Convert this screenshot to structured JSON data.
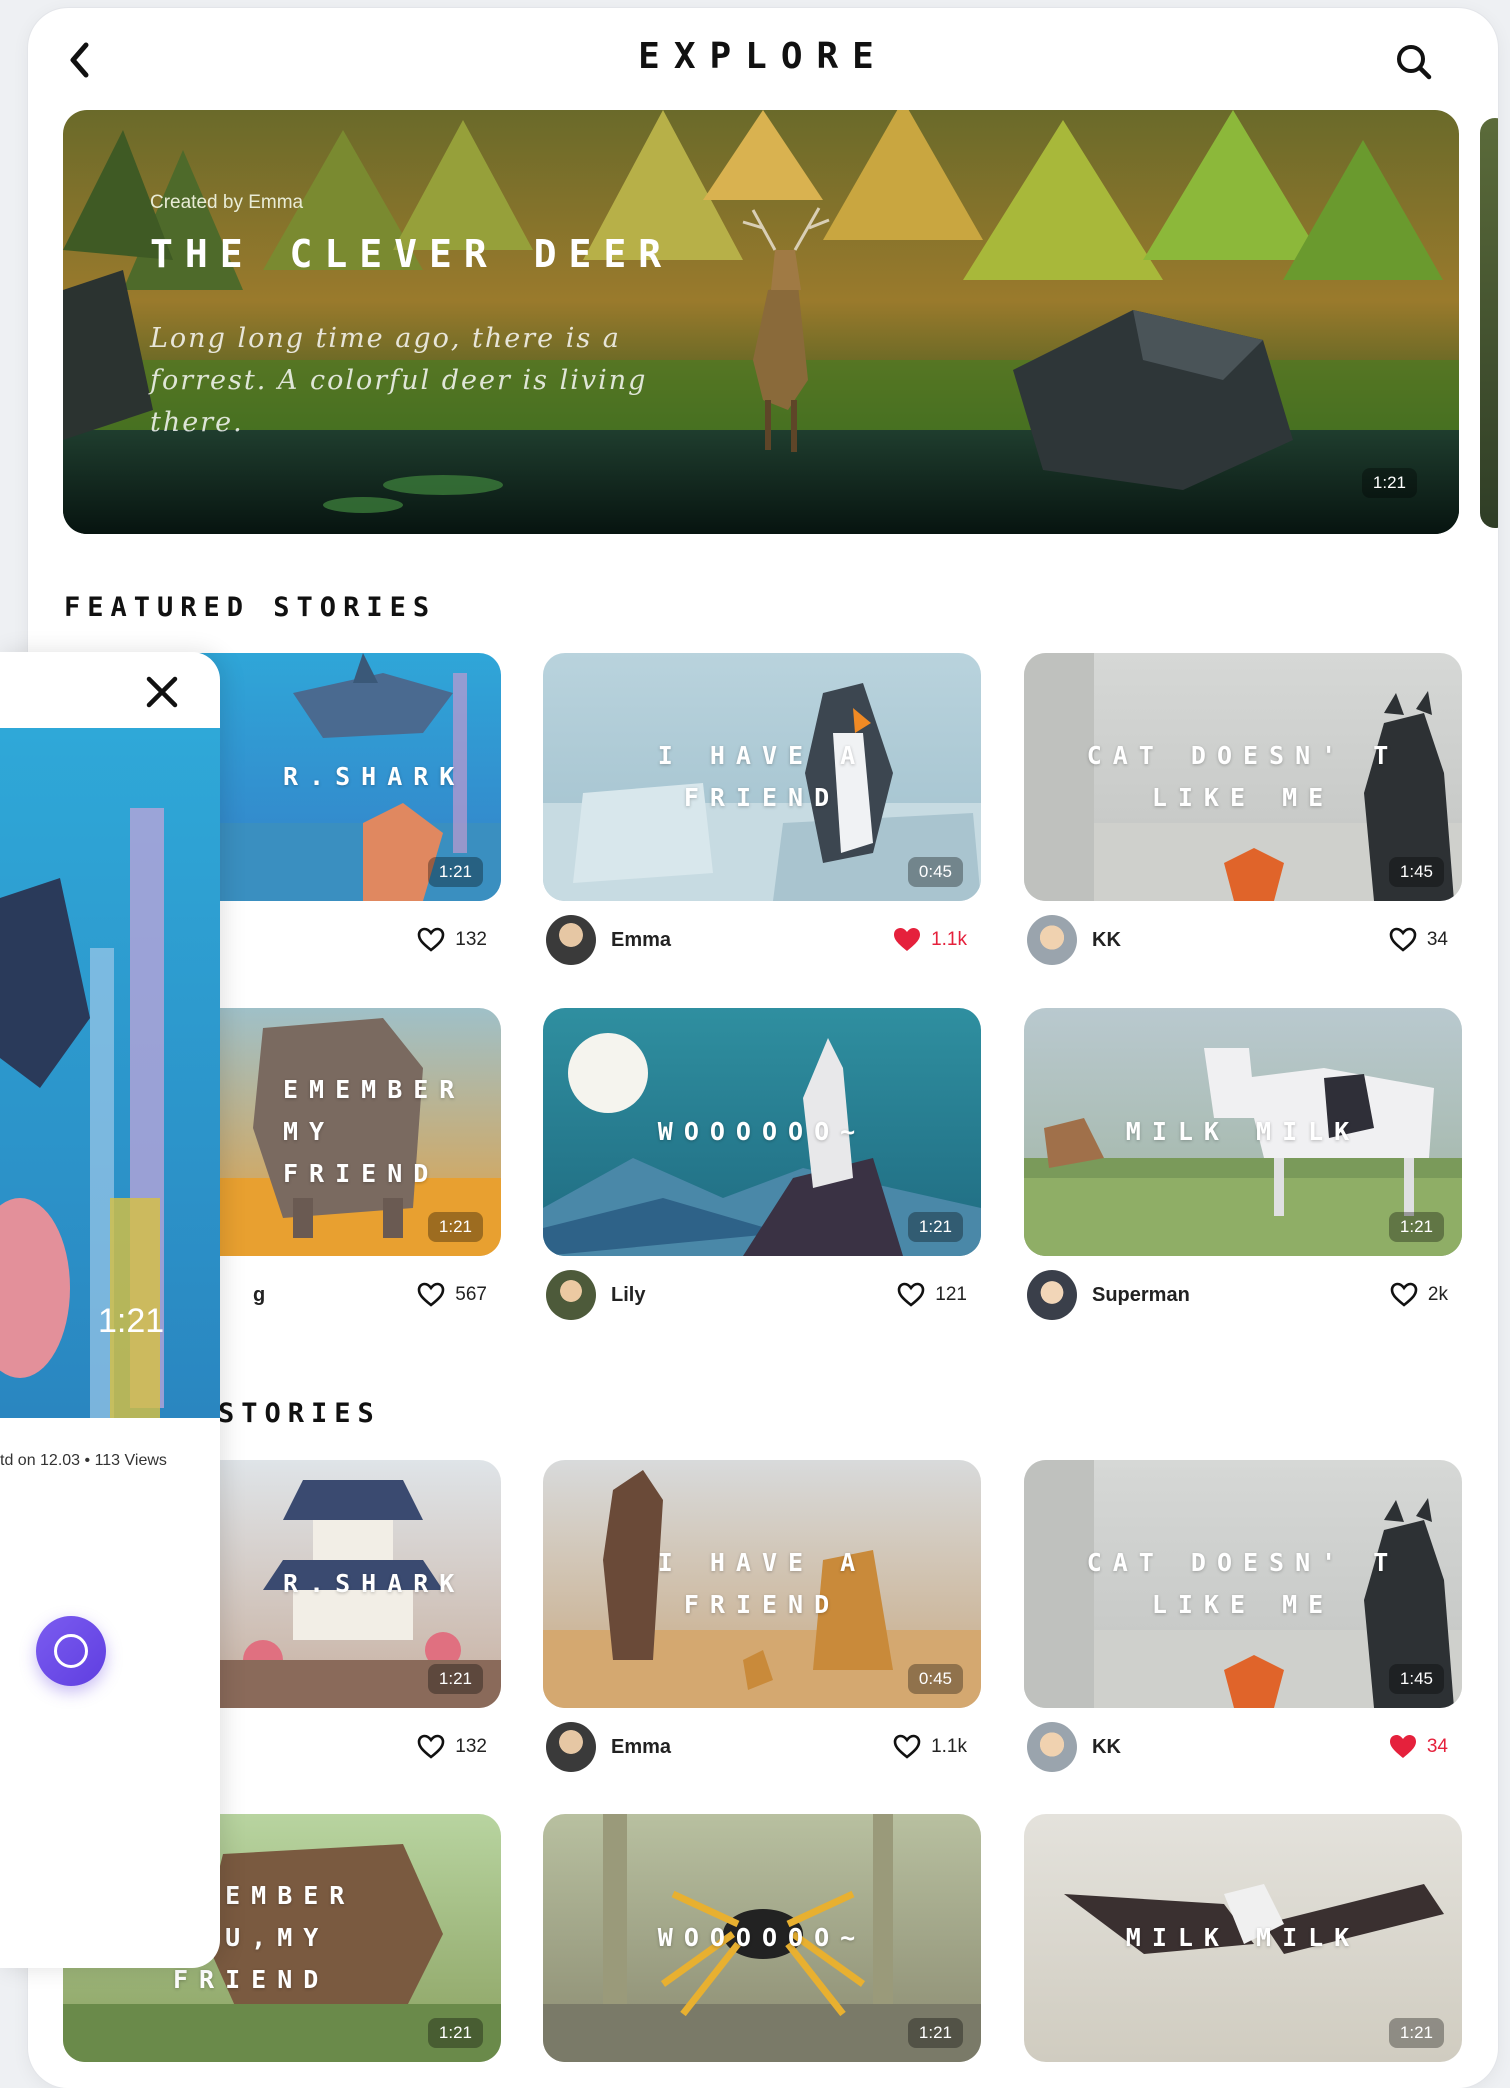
{
  "header": {
    "title": "EXPLORE"
  },
  "hero": {
    "creator": "Created by Emma",
    "title": "THE CLEVER DEER",
    "description": "Long long time ago, there is a forrest. A colorful deer is living there.",
    "duration": "1:21"
  },
  "sections": {
    "featured": "FEATURED STORIES",
    "second": "STORIES"
  },
  "featured_cards": [
    {
      "title": "R.SHARK",
      "duration": "1:21",
      "author": "",
      "likes": "132",
      "liked": false
    },
    {
      "title": "I HAVE A FRIEND",
      "duration": "0:45",
      "author": "Emma",
      "likes": "1.1k",
      "liked": true
    },
    {
      "title": "CAT DOESN' T LIKE ME",
      "duration": "1:45",
      "author": "KK",
      "likes": "34",
      "liked": false
    },
    {
      "title": "EMEMBER MY FRIEND",
      "duration": "1:21",
      "author": "g",
      "likes": "567",
      "liked": false
    },
    {
      "title": "WOOOOOO~",
      "duration": "1:21",
      "author": "Lily",
      "likes": "121",
      "liked": false
    },
    {
      "title": "MILK MILK",
      "duration": "1:21",
      "author": "Superman",
      "likes": "2k",
      "liked": false
    }
  ],
  "second_cards": [
    {
      "title": "R.SHARK",
      "duration": "1:21",
      "author": "",
      "likes": "132",
      "liked": false
    },
    {
      "title": "I HAVE A FRIEND",
      "duration": "0:45",
      "author": "Emma",
      "likes": "1.1k",
      "liked": false
    },
    {
      "title": "CAT DOESN' T LIKE ME",
      "duration": "1:45",
      "author": "KK",
      "likes": "34",
      "liked": true
    },
    {
      "title": "EMEMBER YOU,MY FRIEND",
      "duration": "1:21"
    },
    {
      "title": "WOOOOOO~",
      "duration": "1:21"
    },
    {
      "title": "MILK MILK",
      "duration": "1:21"
    }
  ],
  "panel": {
    "duration": "1:21",
    "info": "td on 12.03 • 113 Views"
  },
  "colors": {
    "liked": "#e5213c",
    "record_button": "#6b4be8"
  },
  "icons": [
    "back-chevron-icon",
    "search-icon",
    "close-icon",
    "heart-icon",
    "record-icon"
  ]
}
